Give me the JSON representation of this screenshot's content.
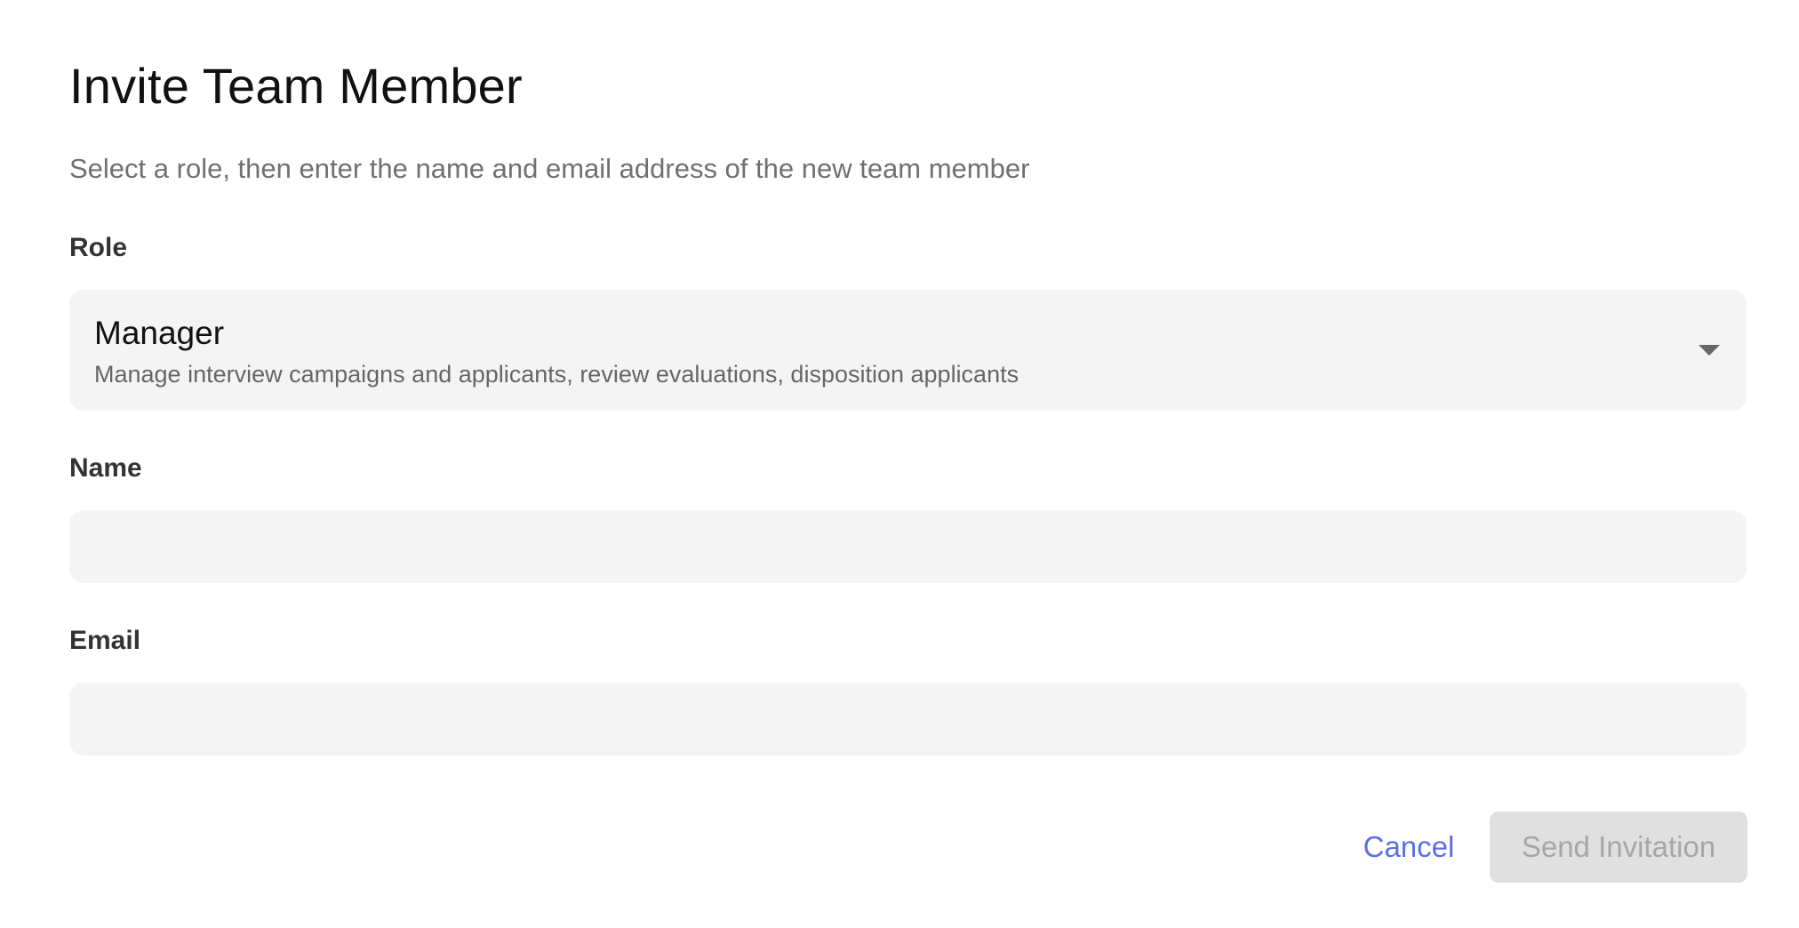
{
  "dialog": {
    "title": "Invite Team Member",
    "subtitle": "Select a role, then enter the name and email address of the new team member"
  },
  "role": {
    "label": "Role",
    "selected_value": "Manager",
    "selected_description": "Manage interview campaigns and applicants, review evaluations, disposition applicants"
  },
  "name": {
    "label": "Name",
    "value": "",
    "placeholder": ""
  },
  "email": {
    "label": "Email",
    "value": "",
    "placeholder": ""
  },
  "actions": {
    "cancel_label": "Cancel",
    "send_label": "Send Invitation",
    "send_disabled": true
  },
  "colors": {
    "accent": "#5a6ee6",
    "field_background": "#f4f4f4",
    "disabled_button_background": "#e0e0e0",
    "disabled_button_text": "#a6a6a6"
  },
  "icons": {
    "role_dropdown": "chevron-down-icon"
  }
}
